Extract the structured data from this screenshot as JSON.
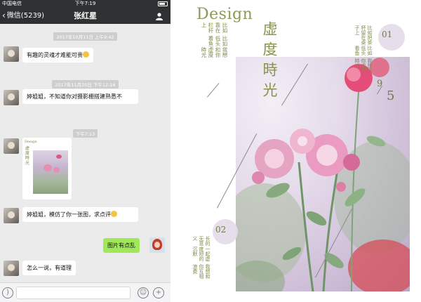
{
  "phone": {
    "status": {
      "carrier": "中国电信",
      "time": "下午7:19"
    },
    "nav": {
      "back_label": "微信(5239)",
      "title": "张红星",
      "contact_icon": "person-icon"
    },
    "messages": [
      {
        "type": "timestamp",
        "text": "2017年10月11日 上午9:42"
      },
      {
        "type": "in",
        "text": "有趣的灵魂才难能可贵",
        "emoji": "grin-emoji"
      },
      {
        "type": "timestamp",
        "text": "2017年11月20日 下午12:16"
      },
      {
        "type": "in",
        "text": "婷姐姐，不知道你对摄影棚搭建熟悉不"
      },
      {
        "type": "timestamp",
        "text": "下午7:13"
      },
      {
        "type": "in-image",
        "thumb_title": "Design"
      },
      {
        "type": "in",
        "text": "婷姐姐，模仿了你一张图，求点评",
        "emoji": "grin-emoji"
      },
      {
        "type": "out",
        "text": "图片有点乱"
      },
      {
        "type": "in",
        "text": "怎么一说，有道理"
      }
    ],
    "input": {
      "voice_icon": "voice-icon",
      "emoji_icon": "emoji-icon",
      "plus_icon": "plus-icon"
    }
  },
  "poster": {
    "title": "Design",
    "big_title": "虚度時光",
    "num_top": "01",
    "num_mid": "9",
    "num_mid2": "5",
    "num_bottom": "02",
    "col_left_top": [
      "我想和你虚度時光",
      "比如低头看鱼",
      "比如靠在栏杆上"
    ],
    "col_right_top": [
      "我想和你虚度時光",
      "比如低头看鱼",
      "比如把茶杯留在桌子上"
    ],
    "col_left_bottom": [
      "我想和你互相浪费",
      "一起虚度短的沉默",
      "长的无意义"
    ],
    "accent": "#8b9a56"
  }
}
